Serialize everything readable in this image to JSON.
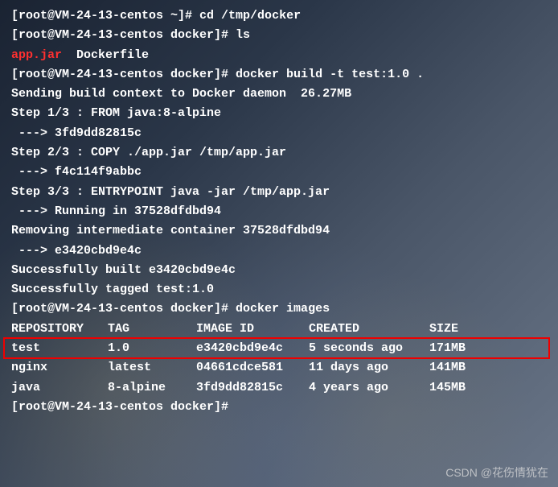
{
  "lines": [
    {
      "type": "prompt",
      "prompt": "[root@VM-24-13-centos ~]#",
      "cmd": " cd /tmp/docker"
    },
    {
      "type": "prompt",
      "prompt": "[root@VM-24-13-centos docker]#",
      "cmd": " ls"
    },
    {
      "type": "lsoutput",
      "file1": "app.jar",
      "file2": "  Dockerfile"
    },
    {
      "type": "prompt",
      "prompt": "[root@VM-24-13-centos docker]#",
      "cmd": " docker build -t test:1.0 ."
    },
    {
      "type": "text",
      "text": "Sending build context to Docker daemon  26.27MB"
    },
    {
      "type": "text",
      "text": "Step 1/3 : FROM java:8-alpine"
    },
    {
      "type": "text",
      "text": " ---> 3fd9dd82815c"
    },
    {
      "type": "text",
      "text": "Step 2/3 : COPY ./app.jar /tmp/app.jar"
    },
    {
      "type": "text",
      "text": " ---> f4c114f9abbc"
    },
    {
      "type": "text",
      "text": "Step 3/3 : ENTRYPOINT java -jar /tmp/app.jar"
    },
    {
      "type": "text",
      "text": " ---> Running in 37528dfdbd94"
    },
    {
      "type": "text",
      "text": "Removing intermediate container 37528dfdbd94"
    },
    {
      "type": "text",
      "text": " ---> e3420cbd9e4c"
    },
    {
      "type": "text",
      "text": "Successfully built e3420cbd9e4c"
    },
    {
      "type": "text",
      "text": "Successfully tagged test:1.0"
    },
    {
      "type": "prompt",
      "prompt": "[root@VM-24-13-centos docker]#",
      "cmd": " docker images"
    }
  ],
  "table": {
    "headers": [
      "REPOSITORY",
      "TAG",
      "IMAGE ID",
      "CREATED",
      "SIZE"
    ],
    "rows": [
      {
        "repo": "test",
        "tag": "1.0",
        "id": "e3420cbd9e4c",
        "created": "5 seconds ago",
        "size": "171MB",
        "highlighted": true
      },
      {
        "repo": "nginx",
        "tag": "latest",
        "id": "04661cdce581",
        "created": "11 days ago",
        "size": "141MB"
      },
      {
        "repo": "java",
        "tag": "8-alpine",
        "id": "3fd9dd82815c",
        "created": "4 years ago",
        "size": "145MB"
      }
    ]
  },
  "finalPrompt": {
    "prompt": "[root@VM-24-13-centos docker]#",
    "cmd": ""
  },
  "watermark": "CSDN @花伤情犹在"
}
